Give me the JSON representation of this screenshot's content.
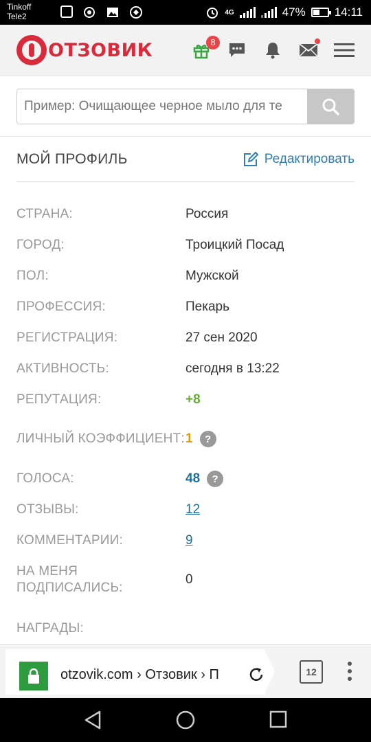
{
  "status_bar": {
    "carrier_line1": "Tinkoff",
    "carrier_line2": "Tele2",
    "network": "4G",
    "battery": "47%",
    "battery_level": 0.47,
    "time": "14:11"
  },
  "header": {
    "logo_text": "ОТЗОВИК",
    "gift_badge": "8",
    "icons": [
      "gift-icon",
      "chat-icon",
      "bell-icon",
      "mail-icon",
      "menu-icon"
    ],
    "brand_color": "#d82b3c"
  },
  "search": {
    "placeholder": "Пример: Очищающее черное мыло для те"
  },
  "profile": {
    "title": "МОЙ ПРОФИЛЬ",
    "edit_label": "Редактировать",
    "rows": [
      {
        "label": "СТРАНА:",
        "value": "Россия"
      },
      {
        "label": "ГОРОД:",
        "value": "Троицкий Посад"
      },
      {
        "label": "ПОЛ:",
        "value": "Мужской"
      },
      {
        "label": "ПРОФЕССИЯ:",
        "value": "Пекарь"
      },
      {
        "label": "РЕГИСТРАЦИЯ:",
        "value": "27 сен 2020"
      },
      {
        "label": "АКТИВНОСТЬ:",
        "value": "сегодня в 13:22"
      },
      {
        "label": "РЕПУТАЦИЯ:",
        "value": "+8"
      },
      {
        "label": "ЛИЧНЫЙ КОЭФФИЦИЕНТ:",
        "value": "1"
      },
      {
        "label": "ГОЛОСА:",
        "value": "48"
      },
      {
        "label": "ОТЗЫВЫ:",
        "value": "12"
      },
      {
        "label": "КОММЕНТАРИИ:",
        "value": "9"
      },
      {
        "label": "НА МЕНЯ ПОДПИСАЛИСЬ:",
        "value": "0"
      },
      {
        "label": "НАГРАДЫ:",
        "value": ""
      }
    ],
    "help_glyph": "?"
  },
  "browser": {
    "url": "otzovik.com › Отзовик › П",
    "tab_count": "12"
  }
}
